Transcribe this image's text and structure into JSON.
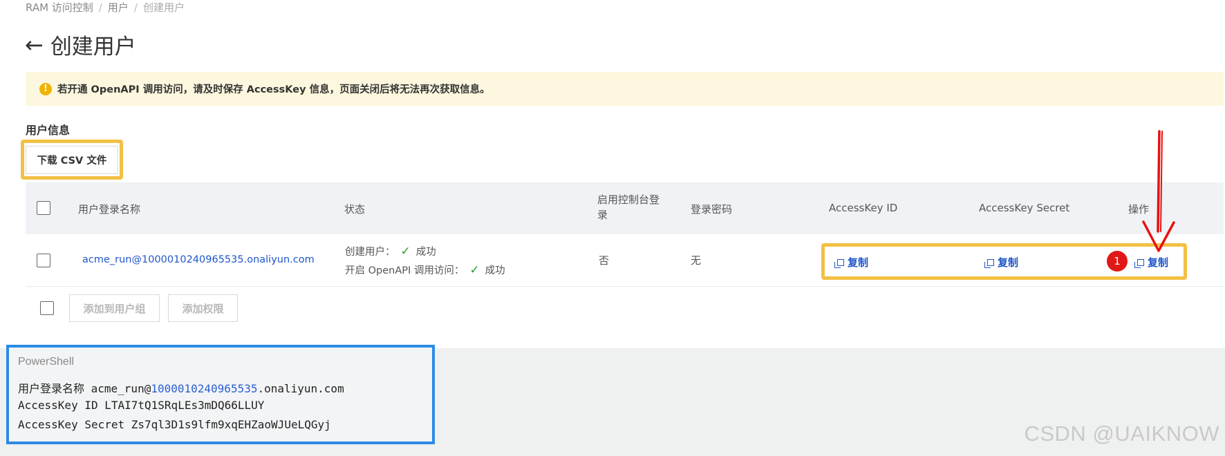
{
  "breadcrumb": [
    "RAM 访问控制",
    "用户",
    "创建用户"
  ],
  "page_title": "创建用户",
  "notice": "若开通 OpenAPI 调用访问，请及时保存 AccessKey 信息，页面关闭后将无法再次获取信息。",
  "section_title": "用户信息",
  "csv_button": "下载 CSV 文件",
  "table": {
    "columns": [
      "用户登录名称",
      "状态",
      "启用控制台登录",
      "登录密码",
      "AccessKey ID",
      "AccessKey Secret",
      "操作"
    ],
    "row": {
      "login_name": "acme_run@1000010240965535.onaliyun.com",
      "status_create": "创建用户：",
      "status_create_result": "成功",
      "status_api": "开启 OpenAPI 调用访问：",
      "status_api_result": "成功",
      "console_login": "否",
      "password": "无",
      "copy_label": "复制"
    }
  },
  "badge_number": "1",
  "bulk_actions": [
    "添加到用户组",
    "添加权限"
  ],
  "powershell": {
    "label": "PowerShell",
    "line1_prefix": "用户登录名称 acme_run@",
    "line1_number": "1000010240965535",
    "line1_suffix": ".onaliyun.com",
    "line2": "AccessKey ID LTAI7tQ1SRqLEs3mDQ66LLUY",
    "line3": "AccessKey Secret Zs7ql3D1s9lfm9xqEHZaoWJUeLQGyj"
  },
  "watermark": "CSDN @UAIKNOW",
  "colors": {
    "link": "#1f56c9",
    "highlight_yellow": "#f3c044",
    "highlight_blue": "#2b8be6",
    "badge_red": "#e01818",
    "notice_bg": "#fcf7de",
    "success_green": "#2ca02c"
  }
}
